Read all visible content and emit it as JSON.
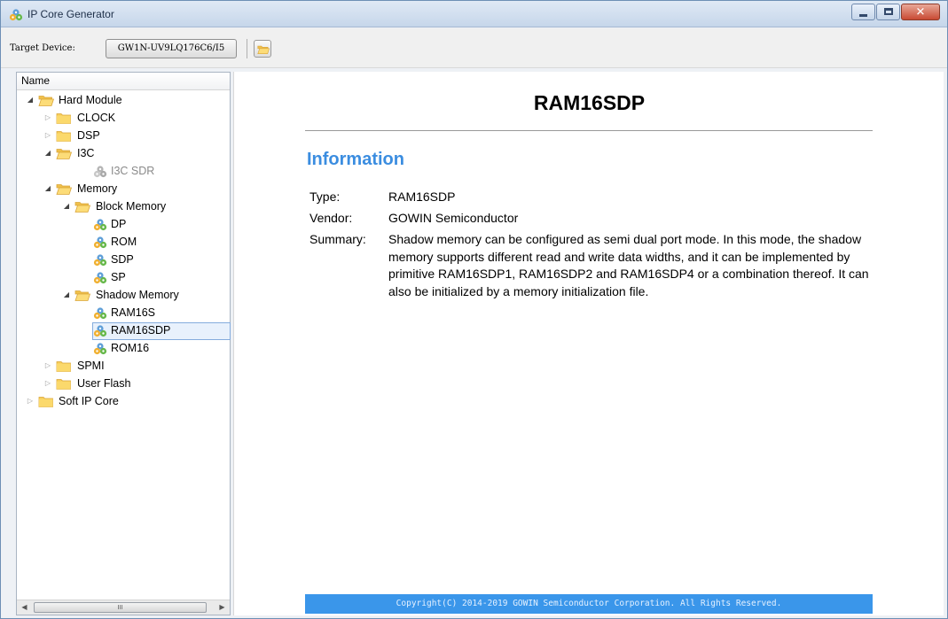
{
  "window": {
    "title": "IP Core Generator"
  },
  "toolbar": {
    "target_label": "Target Device:",
    "device_value": "GW1N-UV9LQ176C6/I5"
  },
  "tree": {
    "header": "Name",
    "items": [
      {
        "label": "Hard Module",
        "state": "expanded"
      },
      {
        "label": "CLOCK",
        "state": "collapsed"
      },
      {
        "label": "DSP",
        "state": "collapsed"
      },
      {
        "label": "I3C",
        "state": "expanded"
      },
      {
        "label": "I3C SDR",
        "state": "disabled"
      },
      {
        "label": "Memory",
        "state": "expanded"
      },
      {
        "label": "Block Memory",
        "state": "expanded"
      },
      {
        "label": "DP"
      },
      {
        "label": "ROM"
      },
      {
        "label": "SDP"
      },
      {
        "label": "SP"
      },
      {
        "label": "Shadow Memory",
        "state": "expanded"
      },
      {
        "label": "RAM16S"
      },
      {
        "label": "RAM16SDP",
        "selected": true
      },
      {
        "label": "ROM16"
      },
      {
        "label": "SPMI",
        "state": "collapsed"
      },
      {
        "label": "User Flash",
        "state": "collapsed"
      },
      {
        "label": "Soft IP Core",
        "state": "collapsed"
      }
    ],
    "scroll_thumb": "III"
  },
  "content": {
    "title": "RAM16SDP",
    "section": "Information",
    "type_label": "Type:",
    "type_value": "RAM16SDP",
    "vendor_label": "Vendor:",
    "vendor_value": "GOWIN Semiconductor",
    "summary_label": "Summary:",
    "summary_value": "Shadow memory can be configured as semi dual port mode. In this mode, the shadow memory supports different read and write data widths, and it can be implemented by primitive RAM16SDP1, RAM16SDP2 and RAM16SDP4 or a combination thereof. It can also be initialized by a memory initialization file.",
    "footer": "Copyright(C) 2014-2019 GOWIN Semiconductor Corporation. All Rights Reserved."
  },
  "colors": {
    "accent": "#3b8de0",
    "footer_bg": "#3a96ea",
    "folder": "#f5c84c",
    "selection": "#e8f1fc"
  }
}
